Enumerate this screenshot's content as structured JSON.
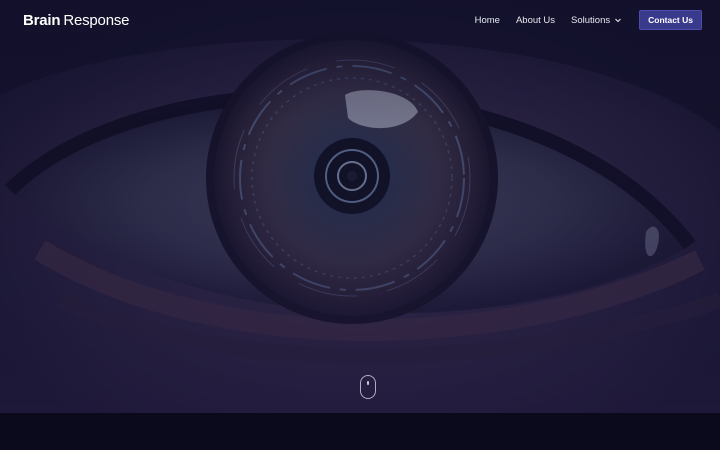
{
  "header": {
    "logo": {
      "bold": "Brain",
      "regular": "Response"
    },
    "nav": [
      {
        "label": "Home"
      },
      {
        "label": "About Us"
      },
      {
        "label": "Solutions"
      }
    ],
    "contact_label": "Contact Us"
  },
  "hero": {
    "image": "close-up-eye-digital-iris",
    "scroll_indicator": "mouse-scroll-icon"
  },
  "colors": {
    "accent": "#3a3a8c",
    "background": "#0b0a1c",
    "overlay": "#1c1840"
  }
}
